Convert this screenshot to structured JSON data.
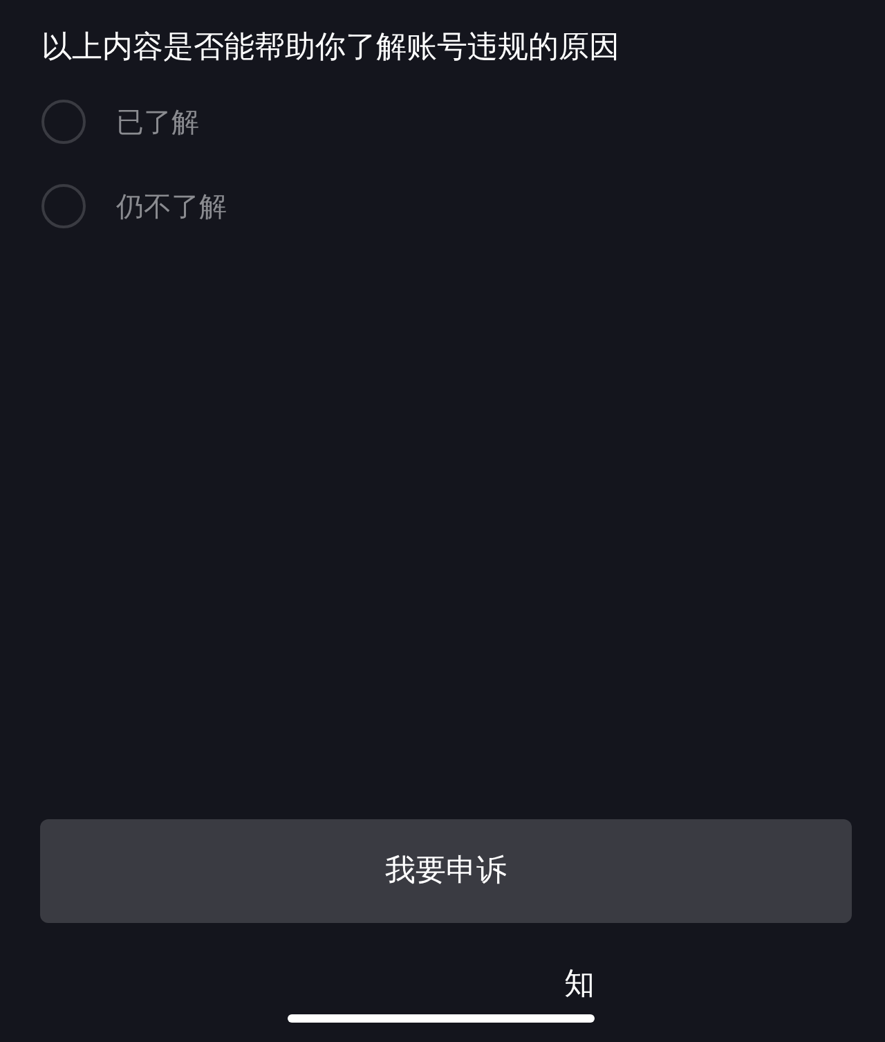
{
  "question": "以上内容是否能帮助你了解账号违规的原因",
  "options": [
    {
      "label": "已了解",
      "selected": false
    },
    {
      "label": "仍不了解",
      "selected": false
    }
  ],
  "appeal_button": "我要申诉",
  "dismiss_link": "知"
}
